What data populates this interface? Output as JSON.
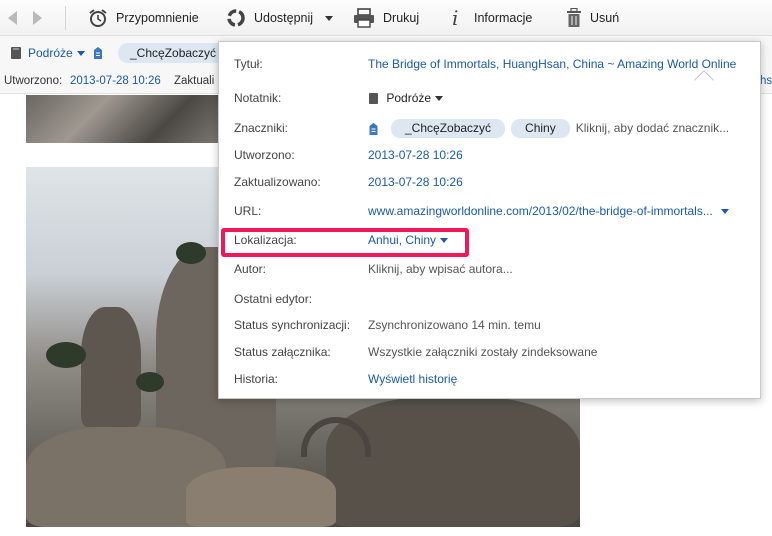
{
  "toolbar": {
    "reminder": "Przypomnienie",
    "share": "Udostępnij",
    "print": "Drukuj",
    "info": "Informacje",
    "delete": "Usuń"
  },
  "note_bar": {
    "notebook": "Podróże",
    "tag": "_ChcęZobaczyć",
    "created_label": "Utworzono:",
    "created_value": "2013-07-28 10:26",
    "updated_label_partial": "Zaktuali",
    "cut_text": "hs"
  },
  "info_popup": {
    "title_label": "Tytuł:",
    "title_value": "The Bridge of Immortals, HuangHsan, China ~ Amazing World Online",
    "notebook_label": "Notatnik:",
    "notebook_value": "Podróże",
    "tags_label": "Znaczniki:",
    "tags": [
      "_ChcęZobaczyć",
      "Chiny"
    ],
    "tags_add_placeholder": "Kliknij, aby dodać znacznik...",
    "created_label": "Utworzono:",
    "created_value": "2013-07-28 10:26",
    "updated_label": "Zaktualizowano:",
    "updated_value": "2013-07-28 10:26",
    "url_label": "URL:",
    "url_value": "www.amazingworldonline.com/2013/02/the-bridge-of-immortals...",
    "location_label": "Lokalizacja:",
    "location_value": "Anhui, Chiny",
    "author_label": "Autor:",
    "author_placeholder": "Kliknij, aby wpisać autora...",
    "last_editor_label": "Ostatni edytor:",
    "sync_label": "Status synchronizacji:",
    "sync_value": "Zsynchronizowano 14 min. temu",
    "attach_label": "Status załącznika:",
    "attach_value": "Wszystkie załączniki zostały zindeksowane",
    "history_label": "Historia:",
    "history_value": "Wyświetl historię"
  },
  "colors": {
    "accent": "#1a5aa8",
    "highlight": "#f0185a",
    "tag_bg": "#dce7f1"
  }
}
